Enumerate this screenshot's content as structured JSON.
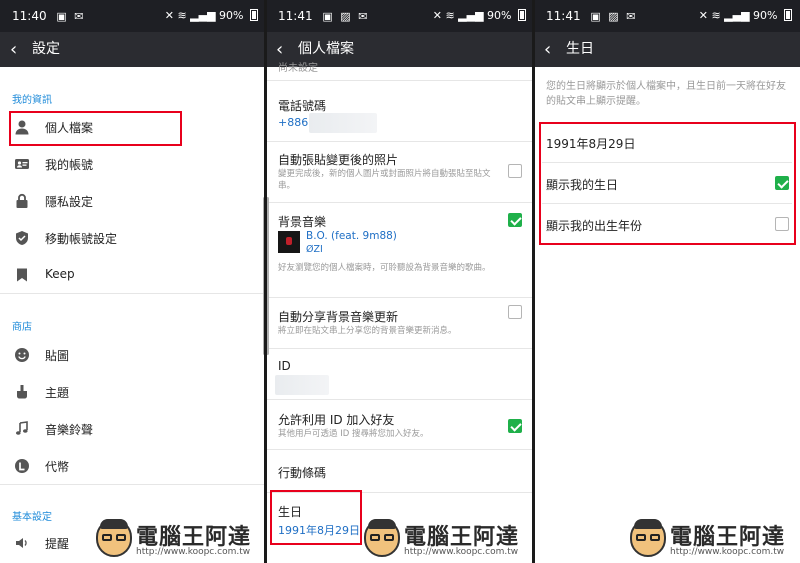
{
  "status": {
    "p1": {
      "time": "11:40",
      "battery": "90%"
    },
    "p2": {
      "time": "11:41",
      "battery": "90%"
    },
    "p3": {
      "time": "11:41",
      "battery": "90%"
    }
  },
  "settings": {
    "title": "設定",
    "sections": {
      "info": "我的資訊",
      "shop": "商店",
      "basic": "基本設定"
    },
    "items": {
      "profile": "個人檔案",
      "account": "我的帳號",
      "privacy": "隱私設定",
      "transfer": "移動帳號設定",
      "keep": "Keep",
      "stickers": "貼圖",
      "themes": "主題",
      "ringtone": "音樂鈴聲",
      "coins": "代幣",
      "reminder": "提醒"
    }
  },
  "profile": {
    "title": "個人檔案",
    "top_cut": "尚未設定",
    "phone": {
      "label": "電話號碼",
      "value": "+886 9"
    },
    "auto_post": {
      "label": "自動張貼變更後的照片",
      "desc": "變更完成後，新的個人圖片或封面照片將自動張貼至貼文串。",
      "checked": false
    },
    "bgm": {
      "label": "背景音樂",
      "song": "B.O. (feat. 9m88)",
      "artist": "ØZI",
      "desc": "好友瀏覽您的個人檔案時，可聆聽設為背景音樂的歌曲。",
      "checked": true
    },
    "auto_share": {
      "label": "自動分享背景音樂更新",
      "desc": "將立即在貼文串上分享您的背景音樂更新消息。",
      "checked": false
    },
    "id": {
      "label": "ID"
    },
    "allow_id": {
      "label": "允許利用 ID 加入好友",
      "desc": "其他用戶可透過 ID 搜尋將您加入好友。",
      "checked": true
    },
    "barcode": {
      "label": "行動條碼"
    },
    "birthday": {
      "label": "生日",
      "value": "1991年8月29日"
    }
  },
  "birthday": {
    "title": "生日",
    "desc": "您的生日將顯示於個人檔案中，且生日前一天將在好友的貼文串上顯示提醒。",
    "date": "1991年8月29日",
    "show_birthday": {
      "label": "顯示我的生日",
      "checked": true
    },
    "show_year": {
      "label": "顯示我的出生年份",
      "checked": false
    }
  },
  "watermark": {
    "name": "電腦王阿達",
    "url": "http://www.koopc.com.tw"
  },
  "colors": {
    "accent_blue": "#1f8bd9",
    "highlight_red": "#e8001c",
    "check_green": "#1fb04a",
    "bar_dark": "#2b2c31"
  }
}
